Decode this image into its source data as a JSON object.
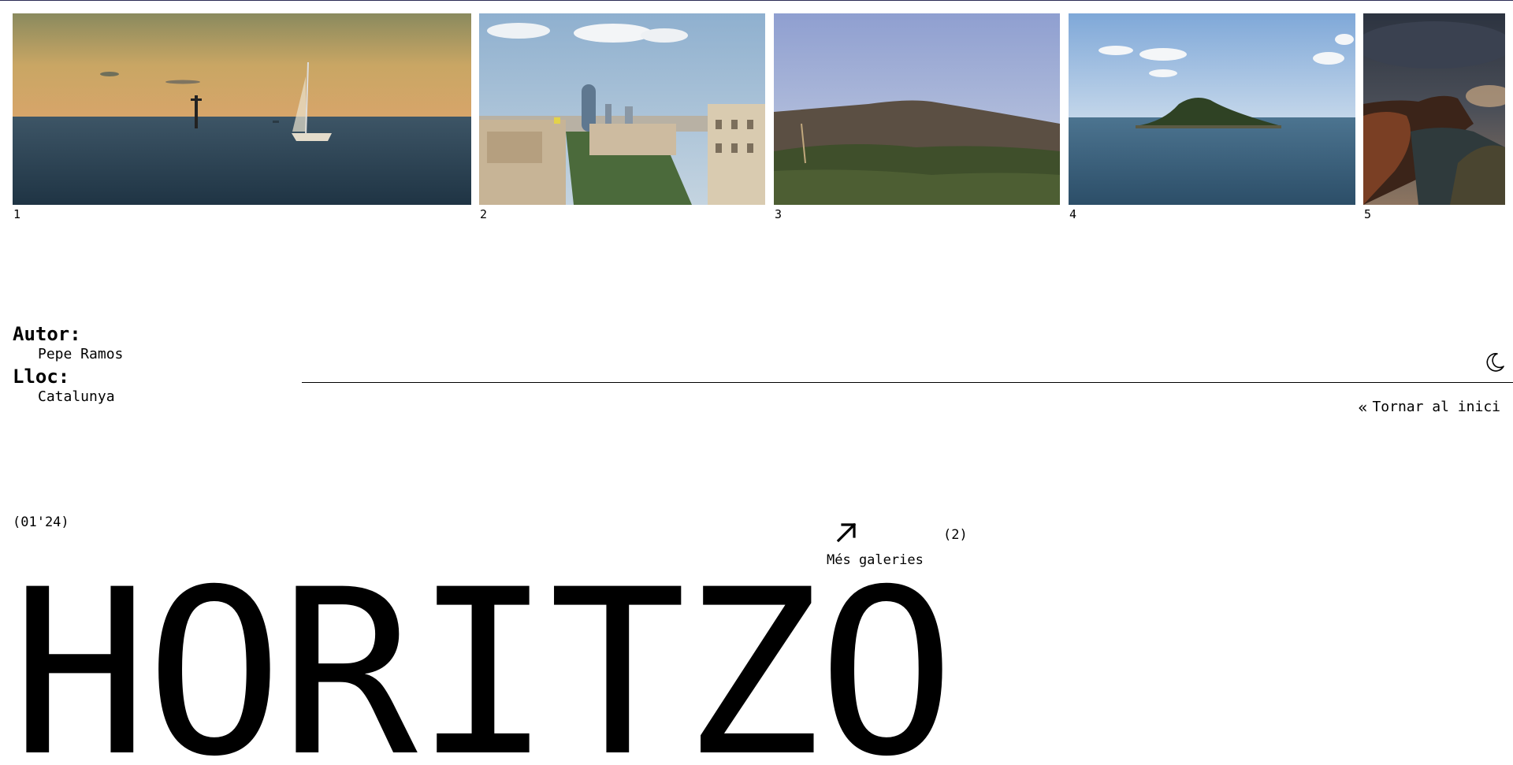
{
  "gallery": {
    "items": [
      {
        "number": "1",
        "alt": "sea-sailboat-sunset"
      },
      {
        "number": "2",
        "alt": "city-skyline"
      },
      {
        "number": "3",
        "alt": "hills-forest"
      },
      {
        "number": "4",
        "alt": "island-sea"
      },
      {
        "number": "5",
        "alt": "cliffs-dusk"
      }
    ]
  },
  "meta": {
    "author_label": "Autor:",
    "author_value": "Pepe Ramos",
    "place_label": "Lloc:",
    "place_value": "Catalunya"
  },
  "controls": {
    "theme_icon": "moon-icon",
    "back_label": "Tornar al inici",
    "back_icon": "double-chevron-left-icon"
  },
  "footer": {
    "date": "(01'24)",
    "more_label": "Més galeries",
    "more_icon": "arrow-up-right-icon",
    "count": "(2)",
    "title": "HORITZO"
  }
}
